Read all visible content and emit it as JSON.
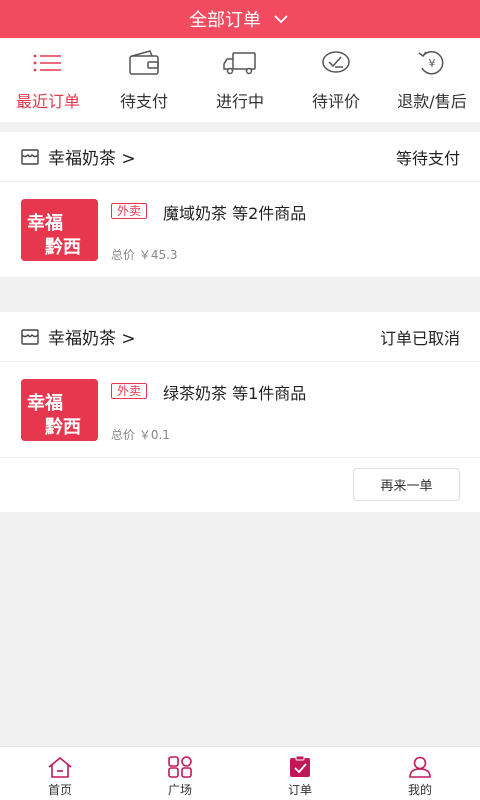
{
  "header": {
    "title": "全部订单"
  },
  "tabs": [
    {
      "label": "最近订单",
      "active": true
    },
    {
      "label": "待支付"
    },
    {
      "label": "进行中"
    },
    {
      "label": "待评价"
    },
    {
      "label": "退款/售后"
    }
  ],
  "orders": [
    {
      "shop": "幸福奶茶 >",
      "status": "等待支付",
      "tag": "外卖",
      "title": "魔域奶茶 等2件商品",
      "price": "总价 ￥45.3",
      "thumb_text": [
        "幸福",
        "黔西"
      ]
    },
    {
      "shop": "幸福奶茶 >",
      "status": "订单已取消",
      "tag": "外卖",
      "title": "绿茶奶茶 等1件商品",
      "price": "总价 ￥0.1",
      "thumb_text": [
        "幸福",
        "黔西"
      ],
      "action": "再来一单"
    }
  ],
  "bottom_nav": [
    {
      "label": "首页"
    },
    {
      "label": "广场"
    },
    {
      "label": "订单"
    },
    {
      "label": "我的"
    }
  ],
  "colors": {
    "accent": "#f24a5f",
    "active_text": "#e8384f"
  }
}
